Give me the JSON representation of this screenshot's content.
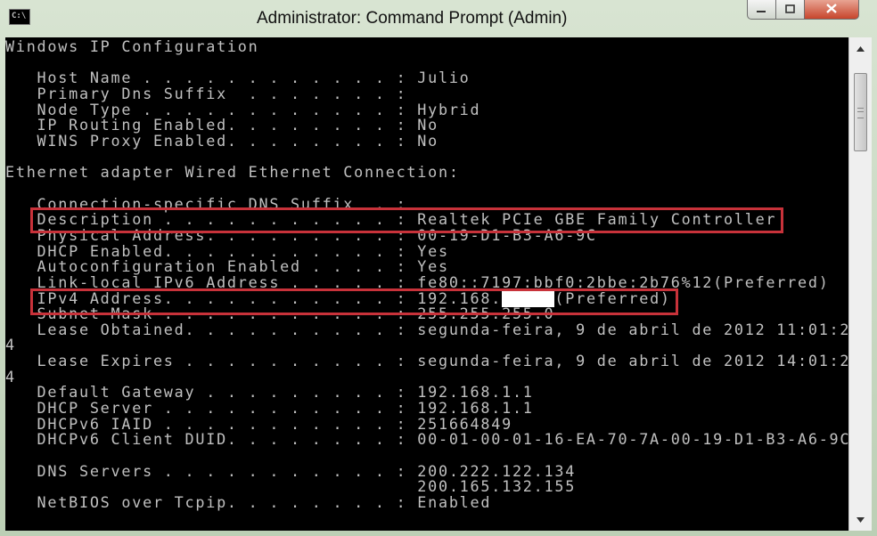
{
  "window": {
    "title": "Administrator: Command Prompt (Admin)",
    "icon_text": "C:\\"
  },
  "controls": {
    "minimize_icon": "minimize-icon",
    "maximize_icon": "maximize-icon",
    "close_icon": "close-icon"
  },
  "highlight_color": "#c8323a",
  "console": {
    "lines": [
      "Windows IP Configuration",
      "",
      "   Host Name . . . . . . . . . . . . : Julio",
      "   Primary Dns Suffix  . . . . . . . :",
      "   Node Type . . . . . . . . . . . . : Hybrid",
      "   IP Routing Enabled. . . . . . . . : No",
      "   WINS Proxy Enabled. . . . . . . . : No",
      "",
      "Ethernet adapter Wired Ethernet Connection:",
      "",
      "   Connection-specific DNS Suffix  . :",
      "   Description . . . . . . . . . . . : Realtek PCIe GBE Family Controller",
      "   Physical Address. . . . . . . . . : 00-19-D1-B3-A6-9C",
      "   DHCP Enabled. . . . . . . . . . . : Yes",
      "   Autoconfiguration Enabled . . . . : Yes",
      "   Link-local IPv6 Address . . . . . : fe80::7197:bbf0:2bbe:2b76%12(Preferred)",
      "   IPv4 Address. . . . . . . . . . . : 192.168",
      "   Subnet Mask . . . . . . . . . . . : 255.255.255.0",
      "   Lease Obtained. . . . . . . . . . : segunda-feira, 9 de abril de 2012 11:01:2",
      "4",
      "   Lease Expires . . . . . . . . . . : segunda-feira, 9 de abril de 2012 14:01:2",
      "4",
      "   Default Gateway . . . . . . . . . : 192.168.1.1",
      "   DHCP Server . . . . . . . . . . . : 192.168.1.1",
      "   DHCPv6 IAID . . . . . . . . . . . : 251664849",
      "   DHCPv6 Client DUID. . . . . . . . : 00-01-00-01-16-EA-70-7A-00-19-D1-B3-A6-9C",
      "",
      "   DNS Servers . . . . . . . . . . . : 200.222.122.134",
      "                                       200.165.132.155",
      "   NetBIOS over Tcpip. . . . . . . . : Enabled"
    ],
    "ipv4_redacted": "XXXXX",
    "ipv4_suffix": "(Preferred)",
    "ipv4_line_index": 16
  }
}
